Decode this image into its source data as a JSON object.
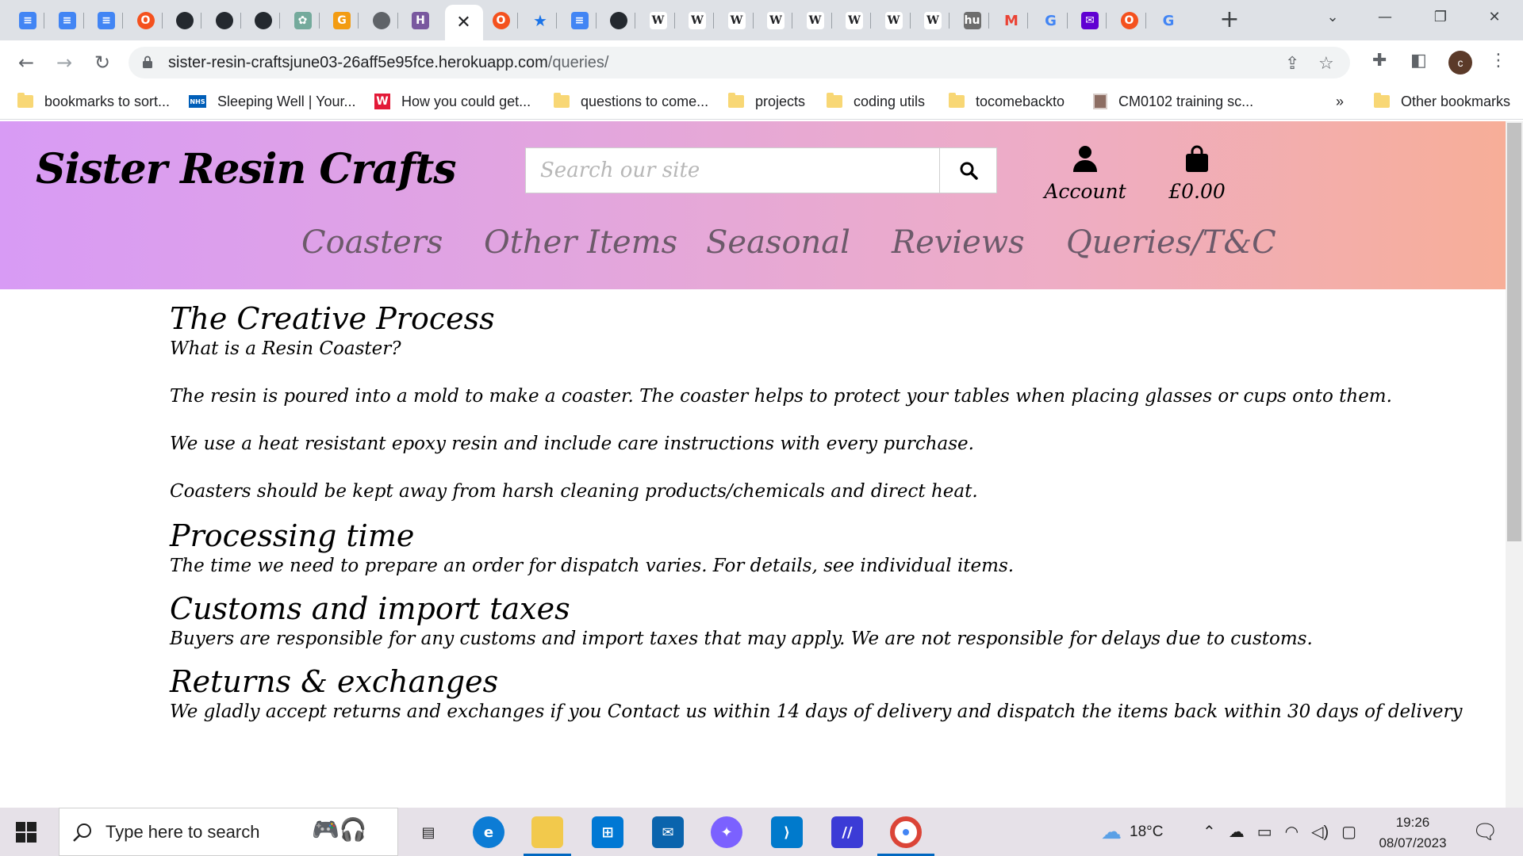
{
  "browser": {
    "tabs": [
      {
        "icon": "google-docs-icon",
        "color": "#4285f4"
      },
      {
        "icon": "google-docs-icon",
        "color": "#4285f4"
      },
      {
        "icon": "google-docs-icon",
        "color": "#4285f4"
      },
      {
        "icon": "circle-o-icon",
        "color": "#f4511e"
      },
      {
        "icon": "github-icon",
        "color": "#24292f"
      },
      {
        "icon": "github-icon",
        "color": "#24292f"
      },
      {
        "icon": "github-icon",
        "color": "#24292f"
      },
      {
        "icon": "chatgpt-icon",
        "color": "#74aa9c"
      },
      {
        "icon": "g-orange-icon",
        "color": "#f39c12"
      },
      {
        "icon": "globe-icon",
        "color": "#5f6368"
      },
      {
        "icon": "heroku-icon",
        "color": "#79589f"
      },
      {
        "icon": "close-icon",
        "active": true
      },
      {
        "icon": "circle-o-icon",
        "color": "#f4511e"
      },
      {
        "icon": "star-icon",
        "color": "#1a73e8"
      },
      {
        "icon": "google-docs-icon",
        "color": "#4285f4"
      },
      {
        "icon": "github-icon",
        "color": "#24292f"
      },
      {
        "icon": "wikipedia-icon",
        "color": "#202124"
      },
      {
        "icon": "wikipedia-icon",
        "color": "#202124"
      },
      {
        "icon": "wikipedia-icon",
        "color": "#202124"
      },
      {
        "icon": "wikipedia-icon",
        "color": "#202124"
      },
      {
        "icon": "wikipedia-icon",
        "color": "#202124"
      },
      {
        "icon": "wikipedia-icon",
        "color": "#202124"
      },
      {
        "icon": "wikipedia-icon",
        "color": "#202124"
      },
      {
        "icon": "wikipedia-icon",
        "color": "#202124"
      },
      {
        "icon": "hu-icon",
        "color": "#6d6d6d"
      },
      {
        "icon": "gmail-icon",
        "color": "#ea4335"
      },
      {
        "icon": "google-icon",
        "color": "#4285f4"
      },
      {
        "icon": "mail-purple-icon",
        "color": "#6001d2"
      },
      {
        "icon": "circle-o-icon",
        "color": "#f4511e"
      },
      {
        "icon": "google-icon",
        "color": "#4285f4"
      }
    ],
    "tab_glyphs": {
      "google-docs-icon": "≡",
      "circle-o-icon": "O",
      "github-icon": "●",
      "chatgpt-icon": "✿",
      "g-orange-icon": "G",
      "globe-icon": "●",
      "heroku-icon": "H",
      "star-icon": "★",
      "wikipedia-icon": "W",
      "hu-icon": "hu",
      "gmail-icon": "M",
      "google-icon": "G",
      "mail-purple-icon": "✉"
    },
    "url_host": "sister-resin-craftsjune03-26aff5e95fce.herokuapp.com",
    "url_path": "/queries/",
    "profile_initial": "c",
    "bookmarks": [
      {
        "label": "bookmarks to sort...",
        "icon": "folder-icon"
      },
      {
        "label": "Sleeping Well | Your...",
        "icon": "nhs-icon"
      },
      {
        "label": "How you could get...",
        "icon": "w-red-icon"
      },
      {
        "label": "questions to come...",
        "icon": "folder-icon"
      },
      {
        "label": "projects",
        "icon": "folder-icon"
      },
      {
        "label": "coding utils",
        "icon": "folder-icon"
      },
      {
        "label": "tocomebackto",
        "icon": "folder-icon"
      },
      {
        "label": "CM0102 training sc...",
        "icon": "thumbnail-icon"
      }
    ],
    "bookmarks_overflow": "»",
    "other_bookmarks": "Other bookmarks",
    "nhs_text": "NHS",
    "w_text": "W"
  },
  "site": {
    "logo": "Sister Resin Crafts",
    "search_placeholder": "Search our site",
    "account_label": "Account",
    "basket_total": "£0.00",
    "nav": [
      "Coasters",
      "Other Items",
      "Seasonal",
      "Reviews",
      "Queries/T&C"
    ]
  },
  "content": {
    "sections": [
      {
        "heading": "The Creative Process",
        "paragraphs": [
          "What is a Resin Coaster?",
          "The resin is poured into a mold to make a coaster. The coaster helps to protect your tables when placing glasses or cups onto them.",
          "We use a heat resistant epoxy resin and include care instructions with every purchase.",
          "Coasters should be kept away from harsh cleaning products/chemicals and direct heat."
        ]
      },
      {
        "heading": "Processing time",
        "paragraphs": [
          "The time we need to prepare an order for dispatch varies. For details, see individual items."
        ]
      },
      {
        "heading": "Customs and import taxes",
        "paragraphs": [
          "Buyers are responsible for any customs and import taxes that may apply. We are not responsible for delays due to customs."
        ]
      },
      {
        "heading": "Returns & exchanges",
        "paragraphs": [
          "We gladly accept returns and exchanges if you Contact us within 14 days of delivery and dispatch the items back within 30 days of delivery"
        ]
      }
    ]
  },
  "taskbar": {
    "search_placeholder": "Type here to search",
    "temperature": "18°C",
    "time": "19:26",
    "date": "08/07/2023"
  }
}
